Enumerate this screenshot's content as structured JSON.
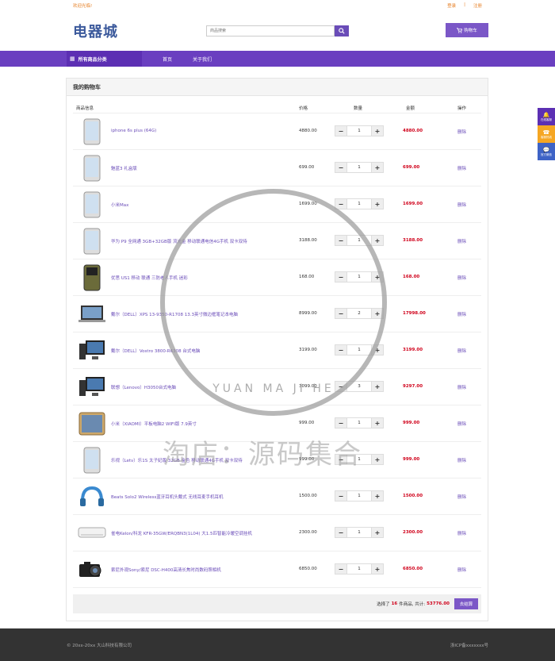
{
  "topbar": {
    "welcome": "欢迎光临!",
    "login": "登录",
    "register": "注册"
  },
  "header": {
    "logo": "电器城",
    "search_placeholder": "商品搜索",
    "cart_label": "购物车"
  },
  "nav": {
    "category": "所有商品分类",
    "items": [
      "首页",
      "关于我们"
    ]
  },
  "cart": {
    "title": "我的购物车",
    "columns": {
      "product": "商品信息",
      "price": "价格",
      "qty": "数量",
      "subtotal": "金额",
      "action": "操作"
    },
    "rows": [
      {
        "name": "iphone 6s plus (64G)",
        "price": "4880.00",
        "qty": "1",
        "subtotal": "4880.00",
        "action": "删除",
        "icon": "phone-icon"
      },
      {
        "name": "魅蓝3 礼盒版",
        "price": "699.00",
        "qty": "1",
        "subtotal": "699.00",
        "action": "删除",
        "icon": "phone-icon"
      },
      {
        "name": "小米Max",
        "price": "1699.00",
        "qty": "1",
        "subtotal": "1699.00",
        "action": "删除",
        "icon": "phone-icon"
      },
      {
        "name": "华为 P9 全网通 3GB+32GB版 流光金 移动联通电信4G手机 双卡双待",
        "price": "3188.00",
        "qty": "1",
        "subtotal": "3188.00",
        "action": "删除",
        "icon": "phone-icon"
      },
      {
        "name": "优思 US1 移动 联通 三防老人手机 迷彩",
        "price": "168.00",
        "qty": "1",
        "subtotal": "168.00",
        "action": "删除",
        "icon": "rugged-phone-icon"
      },
      {
        "name": "戴尔（DELL）XPS 13-9350-R1708 13.3英寸微边框笔记本电脑",
        "price": "8999.00",
        "qty": "2",
        "subtotal": "17998.00",
        "action": "删除",
        "icon": "laptop-icon"
      },
      {
        "name": "戴尔（DELL）Vostro 3800-R6308 台式电脑",
        "price": "3199.00",
        "qty": "1",
        "subtotal": "3199.00",
        "action": "删除",
        "icon": "desktop-icon"
      },
      {
        "name": "联想（Lenovo）H3050台式电脑",
        "price": "3099.00",
        "qty": "3",
        "subtotal": "9297.00",
        "action": "删除",
        "icon": "desktop-icon"
      },
      {
        "name": "小米（XIAOMI）平板电脑2 WIFI版 7.9英寸",
        "price": "999.00",
        "qty": "1",
        "subtotal": "999.00",
        "action": "删除",
        "icon": "tablet-icon"
      },
      {
        "name": "乐视（Letv）乐1S 太子妃版 32GB 金色 移动联通4G手机 双卡双待",
        "price": "999.00",
        "qty": "1",
        "subtotal": "999.00",
        "action": "删除",
        "icon": "phone-icon"
      },
      {
        "name": "Beats Solo2 Wireless蓝牙耳机头戴式 无线耳麦手机耳机",
        "price": "1500.00",
        "qty": "1",
        "subtotal": "1500.00",
        "action": "删除",
        "icon": "headphones-icon"
      },
      {
        "name": "雀电Kelon/科龙 KFR-35GW/ERQBN3(1L04) 大1.5匹智能冷暖空调挂机",
        "price": "2300.00",
        "qty": "1",
        "subtotal": "2300.00",
        "action": "删除",
        "icon": "air-conditioner-icon"
      },
      {
        "name": "索尼外观Sony/索尼 DSC-H400高清长焦时尚数码照相机",
        "price": "6850.00",
        "qty": "1",
        "subtotal": "6850.00",
        "action": "删除",
        "icon": "camera-icon"
      }
    ],
    "summary": {
      "prefix": "选择了",
      "count": "16",
      "mid": "件商品,  共计:",
      "total": "53776.00",
      "checkout": "去结算"
    }
  },
  "side": {
    "s1": "在线客服",
    "s2": "客服热线",
    "s3": "官方微信"
  },
  "footer": {
    "copyright": "© 20xx-20xx 大山科技有限公司",
    "icp": "浙ICP备xxxxxxx号"
  },
  "watermark": {
    "line1": "YUAN MA JI HE",
    "line2": "淘店：源码集合"
  },
  "colors": {
    "accent": "#6a3fc0",
    "price": "#d0021b",
    "link": "#6a4cb8"
  }
}
